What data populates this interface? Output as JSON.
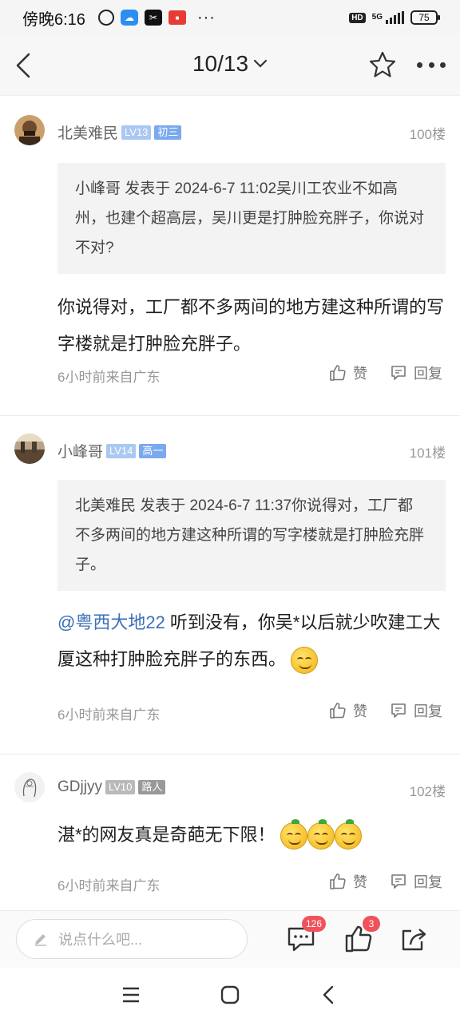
{
  "status_bar": {
    "time": "傍晚6:16",
    "hd": "HD",
    "network": "5G",
    "battery": "75"
  },
  "header": {
    "page_indicator": "10/13"
  },
  "posts": [
    {
      "username": "北美难民",
      "level": "LV13",
      "title_tag": "初三",
      "floor": "100楼",
      "quote": "小峰哥 发表于 2024-6-7 11:02吴川工农业不如高州，也建个超高层，吴川更是打肿脸充胖子，你说对不对?",
      "content": "你说得对，工厂都不多两间的地方建这种所谓的写字楼就是打肿脸充胖子。",
      "meta": "6小时前来自广东",
      "like_label": "赞",
      "reply_label": "回复"
    },
    {
      "username": "小峰哥",
      "level": "LV14",
      "title_tag": "高一",
      "floor": "101楼",
      "quote": "北美难民 发表于 2024-6-7 11:37你说得对，工厂都不多两间的地方建这种所谓的写字楼就是打肿脸充胖子。",
      "mention": "@粤西大地22",
      "content": " 听到没有，你吴*以后就少吹建工大厦这种打肿脸充胖子的东西。",
      "meta": "6小时前来自广东",
      "like_label": "赞",
      "reply_label": "回复"
    },
    {
      "username": "GDjjyy",
      "level": "LV10",
      "title_tag": "路人",
      "floor": "102楼",
      "content": "湛*的网友真是奇葩无下限！",
      "meta": "6小时前来自广东",
      "like_label": "赞",
      "reply_label": "回复"
    }
  ],
  "bottom_bar": {
    "input_placeholder": "说点什么吧...",
    "comment_count": "126",
    "like_count": "3"
  },
  "colors": {
    "accent_blue": "#3b6fb6",
    "badge_red": "#f0525b",
    "level_blue": "#a9c8f2"
  }
}
